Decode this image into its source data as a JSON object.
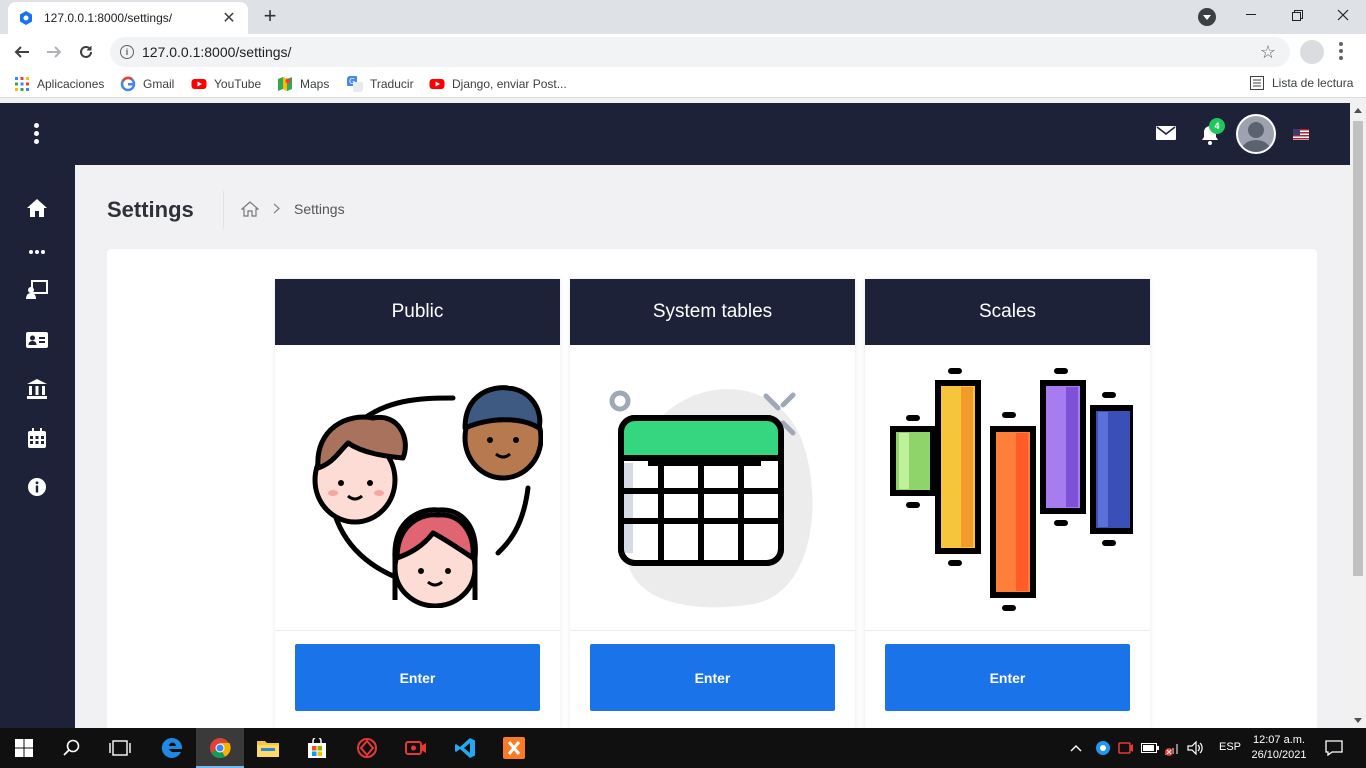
{
  "browser": {
    "tab_title": "127.0.0.1:8000/settings/",
    "url": "127.0.0.1:8000/settings/",
    "bookmarks": [
      {
        "label": "Aplicaciones",
        "icon": "apps-grid-icon"
      },
      {
        "label": "Gmail",
        "icon": "google-icon"
      },
      {
        "label": "YouTube",
        "icon": "youtube-icon"
      },
      {
        "label": "Maps",
        "icon": "maps-icon"
      },
      {
        "label": "Traducir",
        "icon": "translate-icon"
      },
      {
        "label": "Django, enviar Post...",
        "icon": "youtube-icon"
      }
    ],
    "reading_list": "Lista de lectura"
  },
  "header": {
    "notification_count": "4"
  },
  "page": {
    "title": "Settings",
    "breadcrumb_current": "Settings"
  },
  "cards": [
    {
      "title": "Public",
      "button": "Enter",
      "image": "people-illustration"
    },
    {
      "title": "System tables",
      "button": "Enter",
      "image": "table-illustration"
    },
    {
      "title": "Scales",
      "button": "Enter",
      "image": "candlestick-illustration"
    }
  ],
  "taskbar": {
    "language": "ESP",
    "time": "12:07 a.m.",
    "date": "26/10/2021"
  },
  "colors": {
    "navy": "#1d2239",
    "button_blue": "#1a73e8",
    "badge_green": "#22c55e"
  }
}
